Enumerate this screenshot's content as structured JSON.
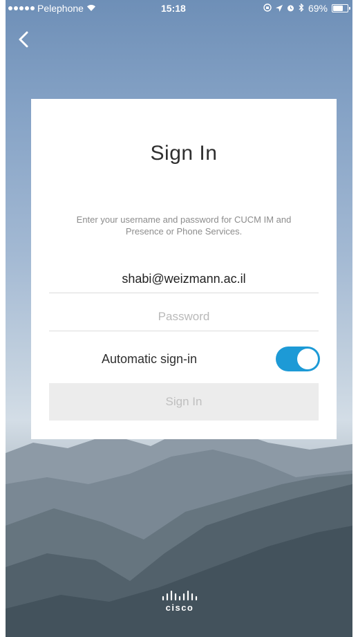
{
  "status_bar": {
    "carrier": "Pelephone",
    "time": "15:18",
    "battery": "69%"
  },
  "nav": {
    "back_icon": "chevron-left-icon"
  },
  "signin_card": {
    "title": "Sign In",
    "subtitle": "Enter your username and password for CUCM IM and Presence or Phone Services.",
    "username_value": "shabi@weizmann.ac.il",
    "password_placeholder": "Password",
    "auto_signin_label": "Automatic sign-in",
    "auto_signin_enabled": true,
    "signin_button_label": "Sign In"
  },
  "branding": {
    "logo_text": "cisco"
  },
  "colors": {
    "accent": "#1d9ad6",
    "button_disabled": "#ececec"
  }
}
